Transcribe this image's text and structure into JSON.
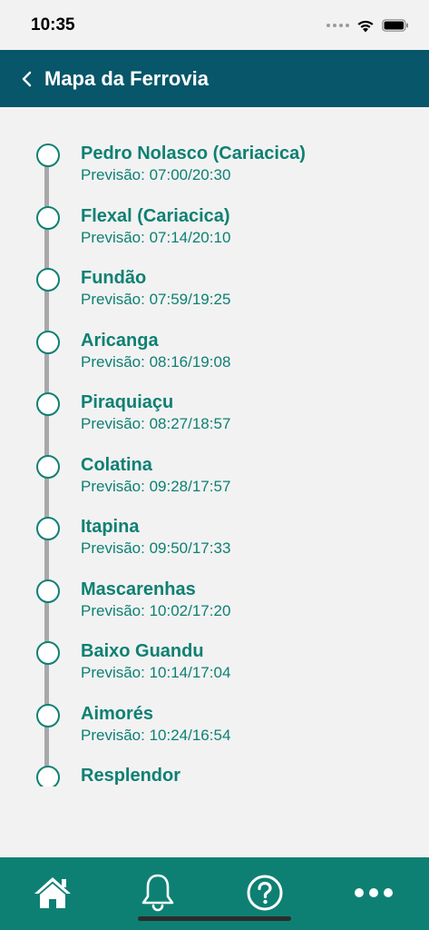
{
  "status_bar": {
    "time": "10:35"
  },
  "header": {
    "title": "Mapa da Ferrovia"
  },
  "stations": [
    {
      "name": "Pedro Nolasco (Cariacica)",
      "forecast": "Previsão: 07:00/20:30"
    },
    {
      "name": "Flexal (Cariacica)",
      "forecast": "Previsão: 07:14/20:10"
    },
    {
      "name": "Fundão",
      "forecast": "Previsão: 07:59/19:25"
    },
    {
      "name": "Aricanga",
      "forecast": "Previsão: 08:16/19:08"
    },
    {
      "name": "Piraquiaçu",
      "forecast": "Previsão: 08:27/18:57"
    },
    {
      "name": "Colatina",
      "forecast": "Previsão: 09:28/17:57"
    },
    {
      "name": "Itapina",
      "forecast": "Previsão: 09:50/17:33"
    },
    {
      "name": "Mascarenhas",
      "forecast": "Previsão: 10:02/17:20"
    },
    {
      "name": "Baixo Guandu",
      "forecast": "Previsão: 10:14/17:04"
    },
    {
      "name": "Aimorés",
      "forecast": "Previsão: 10:24/16:54"
    },
    {
      "name": "Resplendor",
      "forecast": ""
    }
  ],
  "tab_bar": {
    "tabs": [
      {
        "icon": "home-icon"
      },
      {
        "icon": "bell-icon"
      },
      {
        "icon": "help-icon"
      },
      {
        "icon": "more-icon"
      }
    ]
  },
  "colors": {
    "header_bg": "#075669",
    "accent": "#0e8073",
    "background": "#f2f2f2"
  }
}
